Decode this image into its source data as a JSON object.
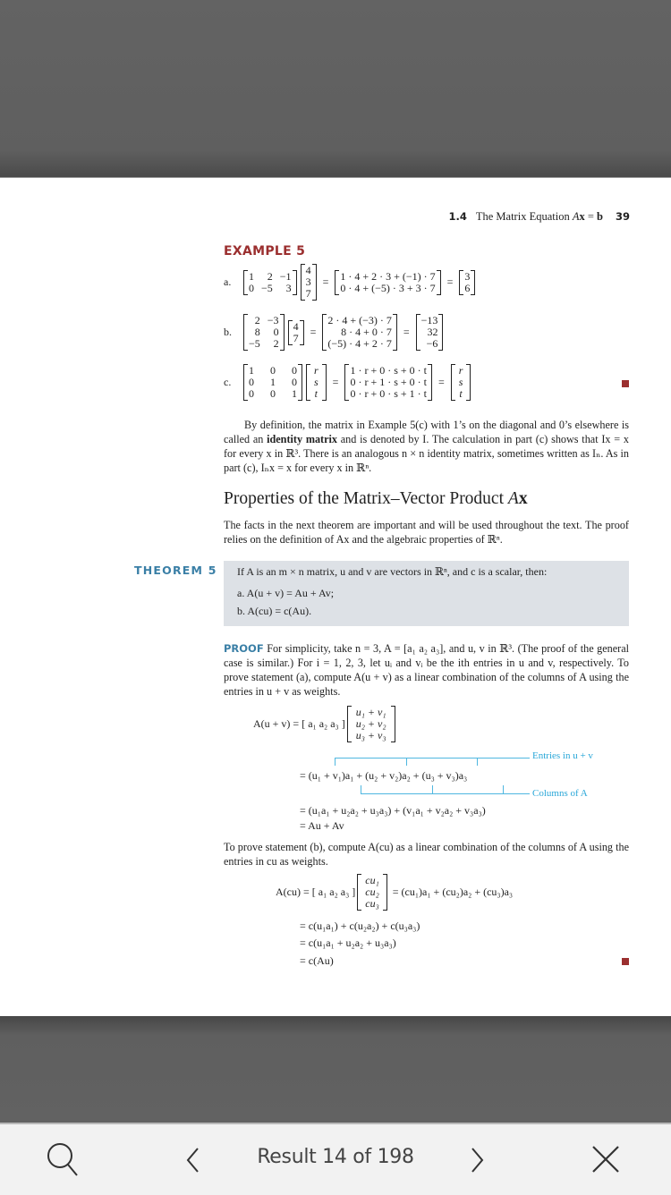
{
  "running_head": {
    "section": "1.4",
    "title_pre": "The Matrix Equation ",
    "title_A": "A",
    "title_x": "x",
    "title_eq": " = ",
    "title_b": "b",
    "page": "39"
  },
  "example": {
    "title": "EXAMPLE 5",
    "a": {
      "label": "a.",
      "matrix": [
        "1",
        "2",
        "−1",
        "0",
        "−5",
        "3"
      ],
      "vector": [
        "4",
        "3",
        "7"
      ],
      "expanded": [
        "1 · 4 + 2 · 3 + (−1) · 7",
        "0 · 4 + (−5) · 3 + 3 · 7"
      ],
      "result": [
        "3",
        "6"
      ]
    },
    "b": {
      "label": "b.",
      "matrix": [
        "2",
        "−3",
        "8",
        "0",
        "−5",
        "2"
      ],
      "vector": [
        "4",
        "7"
      ],
      "expanded": [
        "2 · 4 + (−3) · 7",
        "8 · 4 + 0 · 7",
        "(−5) · 4 + 2 · 7"
      ],
      "result": [
        "−13",
        "32",
        "−6"
      ]
    },
    "c": {
      "label": "c.",
      "matrix": [
        "1",
        "0",
        "0",
        "0",
        "1",
        "0",
        "0",
        "0",
        "1"
      ],
      "vector": [
        "r",
        "s",
        "t"
      ],
      "expanded": [
        "1 · r + 0 · s + 0 · t",
        "0 · r + 1 · s + 0 · t",
        "0 · r + 0 · s + 1 · t"
      ],
      "result": [
        "r",
        "s",
        "t"
      ]
    }
  },
  "identity_paragraph": {
    "p1": "By definition, the matrix in Example 5(c) with 1’s on the diagonal and 0’s elsewhere is called an ",
    "bold": "identity matrix",
    "p2": " and is denoted by I. The calculation in part (c) shows that Ix = x for every x in ℝ³. There is an analogous n × n identity matrix, sometimes written as Iₙ. As in part (c), Iₙx = x for every x in ℝⁿ."
  },
  "section_heading": {
    "text": "Properties of the Matrix–Vector Product ",
    "A": "A",
    "x": "x"
  },
  "section_intro": "The facts in the next theorem are important and will be used throughout the text. The proof relies on the definition of Ax and the algebraic properties of ℝⁿ.",
  "theorem": {
    "label": "THEOREM 5",
    "statement": "If A is an m × n matrix, u and v are vectors in ℝⁿ, and c is a scalar, then:",
    "a": "a.  A(u + v) = Au + Av;",
    "b": "b.  A(cu) = c(Au)."
  },
  "proof": {
    "keyword": "PROOF",
    "intro": "For simplicity, take n = 3, A = [a₁  a₂  a₃], and u, v in ℝ³. (The proof of the general case is similar.) For i = 1, 2, 3, let uᵢ and vᵢ be the ith entries in u and v, respectively. To prove statement (a), compute A(u + v) as a linear combination of the columns of A using the entries in u + v as weights.",
    "eq1_lhs": "A(u + v) = [ a₁   a₂   a₃ ]",
    "eq1_vector": [
      "u₁ + v₁",
      "u₂ + v₂",
      "u₃ + v₃"
    ],
    "eq2": "= (u₁ + v₁)a₁ + (u₂ + v₂)a₂ + (u₃ + v₃)a₃",
    "annot_entries": "Entries in u + v",
    "annot_columns": "Columns of A",
    "eq3": "= (u₁a₁ + u₂a₂ + u₃a₃) + (v₁a₁ + v₂a₂ + v₃a₃)",
    "eq4": "= Au + Av",
    "part_b_intro": "To prove statement (b), compute A(cu) as a linear combination of the columns of A using the entries in cu as weights.",
    "eq5_lhs": "A(cu) = [ a₁   a₂   a₃ ]",
    "eq5_vector": [
      "cu₁",
      "cu₂",
      "cu₃"
    ],
    "eq5_rhs": "= (cu₁)a₁ + (cu₂)a₂ + (cu₃)a₃",
    "eq6": "= c(u₁a₁) + c(u₂a₂) + c(u₃a₃)",
    "eq7": "= c(u₁a₁ + u₂a₂ + u₃a₃)",
    "eq8": "= c(Au)"
  },
  "toolbar": {
    "search_icon": "search-icon",
    "prev_icon": "chevron-left-icon",
    "result_text": "Result 14 of 198",
    "next_icon": "chevron-right-icon",
    "close_icon": "close-icon"
  },
  "colors": {
    "accent_red": "#9b2f2f",
    "accent_blue": "#3a7fa6",
    "annotation_cyan": "#29a7d8",
    "theorem_bg": "#dde1e6"
  }
}
